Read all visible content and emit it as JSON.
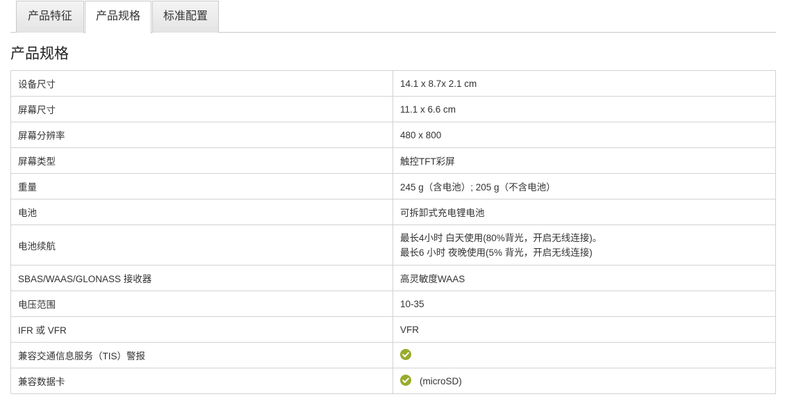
{
  "tabs": [
    {
      "label": "产品特征",
      "active": false
    },
    {
      "label": "产品规格",
      "active": true
    },
    {
      "label": "标准配置",
      "active": false
    }
  ],
  "section_title": "产品规格",
  "accent_color": "#9aab2b",
  "specs": [
    {
      "key": "设备尺寸",
      "value": "14.1 x 8.7x 2.1 cm"
    },
    {
      "key": "屏幕尺寸",
      "value": "11.1 x 6.6 cm"
    },
    {
      "key": "屏幕分辨率",
      "value": "480 x 800"
    },
    {
      "key": "屏幕类型",
      "value": "触控TFT彩屏"
    },
    {
      "key": "重量",
      "value": "245 g（含电池）; 205 g（不含电池）"
    },
    {
      "key": "电池",
      "value": "可拆卸式充电锂电池"
    },
    {
      "key": "电池续航",
      "value_lines": [
        "最长4小时 白天使用(80%背光，开启无线连接)。",
        "最长6 小时 夜晚使用(5% 背光，开启无线连接)"
      ]
    },
    {
      "key": "SBAS/WAAS/GLONASS 接收器",
      "value": "高灵敏度WAAS"
    },
    {
      "key": "电压范围",
      "value": "10-35"
    },
    {
      "key": "IFR 或 VFR",
      "value": "VFR"
    },
    {
      "key": "兼容交通信息服务（TIS）警报",
      "icon": "check-circle-icon",
      "value": ""
    },
    {
      "key": "兼容数据卡",
      "icon": "check-circle-icon",
      "value": "(microSD)"
    }
  ]
}
